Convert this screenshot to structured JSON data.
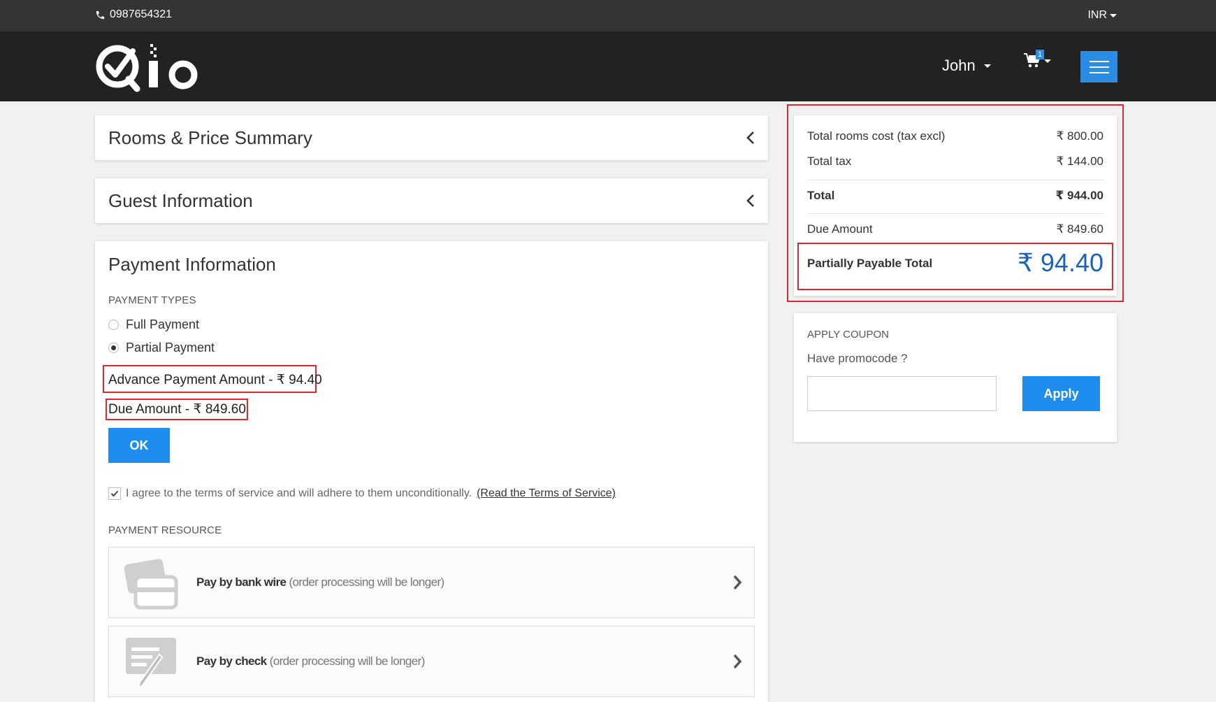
{
  "topbar": {
    "phone": "0987654321",
    "currency": "INR"
  },
  "header": {
    "brand": "Qlo",
    "user_name": "John",
    "cart_count": "1"
  },
  "sections": {
    "rooms_summary": "Rooms & Price Summary",
    "guest_info": "Guest Information"
  },
  "payment": {
    "title": "Payment Information",
    "types_label": "PAYMENT TYPES",
    "options": [
      "Full Payment",
      "Partial Payment"
    ],
    "selected": "Partial Payment",
    "advance_line": "Advance Payment Amount - ₹ 94.40",
    "due_line": "Due Amount - ₹ 849.60",
    "ok_label": "OK",
    "terms_text": "I agree to the terms of service and will adhere to them unconditionally.",
    "terms_link": "(Read the Terms of Service)",
    "terms_checked": true,
    "resource_label": "PAYMENT RESOURCE",
    "methods": [
      {
        "name": "Pay by bank wire",
        "note": "(order processing will be longer)"
      },
      {
        "name": "Pay by check",
        "note": "(order processing will be longer)"
      }
    ]
  },
  "summary": {
    "rooms_cost_label": "Total rooms cost (tax excl)",
    "rooms_cost_value": "₹ 800.00",
    "tax_label": "Total tax",
    "tax_value": "₹ 144.00",
    "total_label": "Total",
    "total_value": "₹ 944.00",
    "due_label": "Due Amount",
    "due_value": "₹ 849.60",
    "partial_label": "Partially Payable Total",
    "partial_value": "₹ 94.40"
  },
  "coupon": {
    "label": "APPLY COUPON",
    "question": "Have promocode ?",
    "input_value": "",
    "apply_label": "Apply"
  },
  "colors": {
    "accent": "#1f8ded",
    "highlight_border": "#e3262b",
    "partial_total": "#1d63b5",
    "header_bg": "#222222",
    "topbar_bg": "#343434"
  }
}
